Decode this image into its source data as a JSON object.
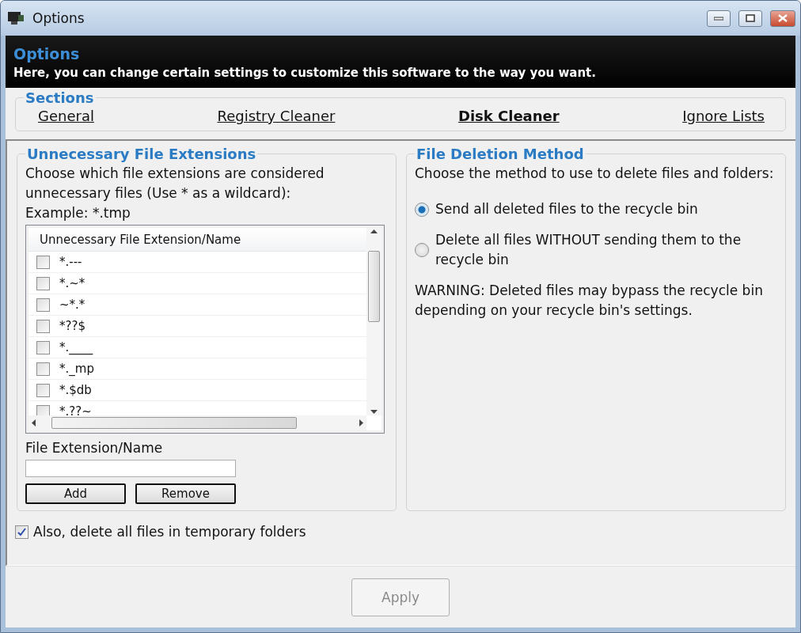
{
  "window": {
    "title": "Options"
  },
  "header": {
    "title": "Options",
    "subtitle": "Here, you can change certain settings to customize this software to the way you want."
  },
  "sections": {
    "legend": "Sections",
    "tabs": [
      {
        "label": "General",
        "selected": false
      },
      {
        "label": "Registry Cleaner",
        "selected": false
      },
      {
        "label": "Disk Cleaner",
        "selected": true
      },
      {
        "label": "Ignore Lists",
        "selected": false
      }
    ]
  },
  "extensions": {
    "legend": "Unnecessary File Extensions",
    "description": "Choose which file extensions are considered unnecessary files (Use * as a wildcard):",
    "example": "Example: *.tmp",
    "list": {
      "column": "Unnecessary File Extension/Name",
      "rows": [
        {
          "text": "*.---",
          "checked": false
        },
        {
          "text": "*.~*",
          "checked": false
        },
        {
          "text": "~*.*",
          "checked": false
        },
        {
          "text": "*??$",
          "checked": false
        },
        {
          "text": "*.____",
          "checked": false
        },
        {
          "text": "*._mp",
          "checked": false
        },
        {
          "text": "*.$db",
          "checked": false
        },
        {
          "text": "*.??~",
          "checked": false
        }
      ]
    },
    "field_label": "File Extension/Name",
    "buttons": [
      "Add",
      "Remove"
    ]
  },
  "deletion": {
    "legend": "File Deletion Method",
    "description": "Choose the method to use to delete files and folders:",
    "options": [
      {
        "label": "Send all deleted files to the recycle bin",
        "selected": true
      },
      {
        "label": "Delete all files WITHOUT sending them to the recycle bin",
        "selected": false
      }
    ],
    "warning": "WARNING: Deleted files may bypass the recycle bin depending on your recycle bin's settings."
  },
  "temp_folders": {
    "label": "Also, delete all files in temporary folders",
    "checked": true
  },
  "apply": {
    "label": "Apply",
    "disabled": true
  }
}
